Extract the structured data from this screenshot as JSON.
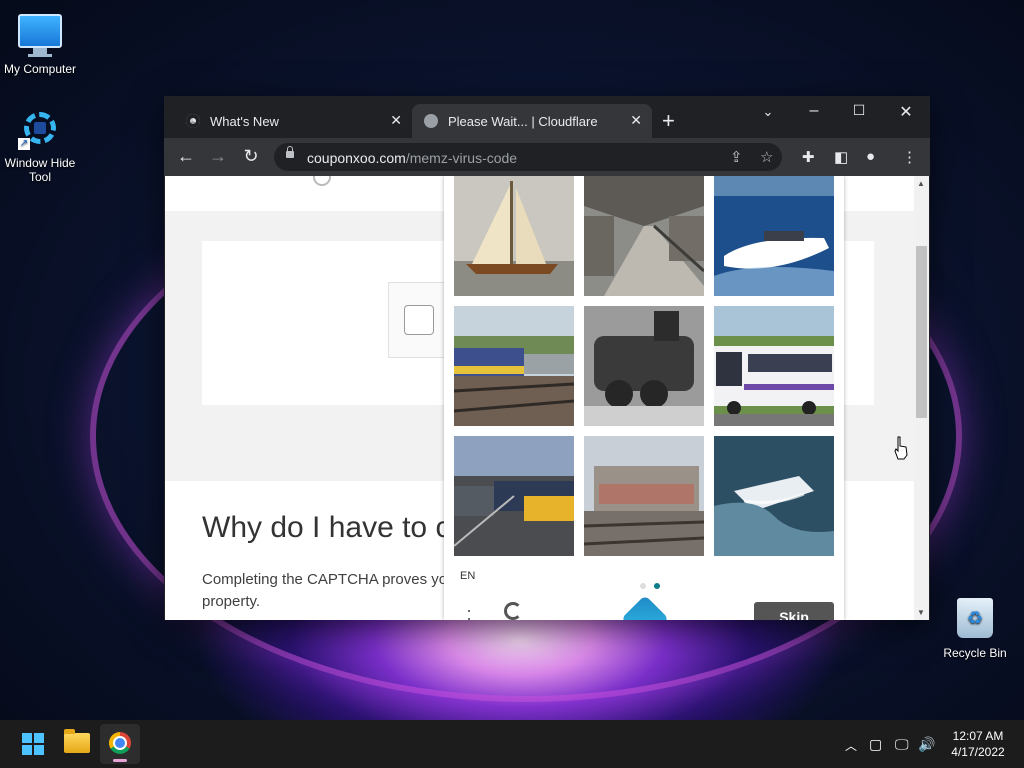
{
  "desktop": {
    "icons": [
      {
        "label": "My Computer"
      },
      {
        "label": "Window Hide Tool"
      },
      {
        "label": "Recycle Bin"
      }
    ]
  },
  "browser": {
    "tabs": [
      {
        "title": "What's New",
        "active": false
      },
      {
        "title": "Please Wait... | Cloudflare",
        "active": true
      }
    ],
    "url": {
      "domain": "couponxoo.com",
      "path": "/memz-virus-code"
    }
  },
  "page": {
    "heading": "Why do I have to c",
    "paragraph": "Completing the CAPTCHA proves yo",
    "paragraph_continued": "property."
  },
  "captcha": {
    "tiles": [
      "sailboat",
      "train-station-platform",
      "speedboat",
      "commuter-train",
      "steam-locomotive",
      "city-bus",
      "trains-in-yard",
      "graffiti-train",
      "speedboat-wake"
    ],
    "language": "EN",
    "skip_label": "Skip",
    "accent_color": "#0b7a8a"
  },
  "taskbar": {
    "time": "12:07 AM",
    "date": "4/17/2022"
  }
}
